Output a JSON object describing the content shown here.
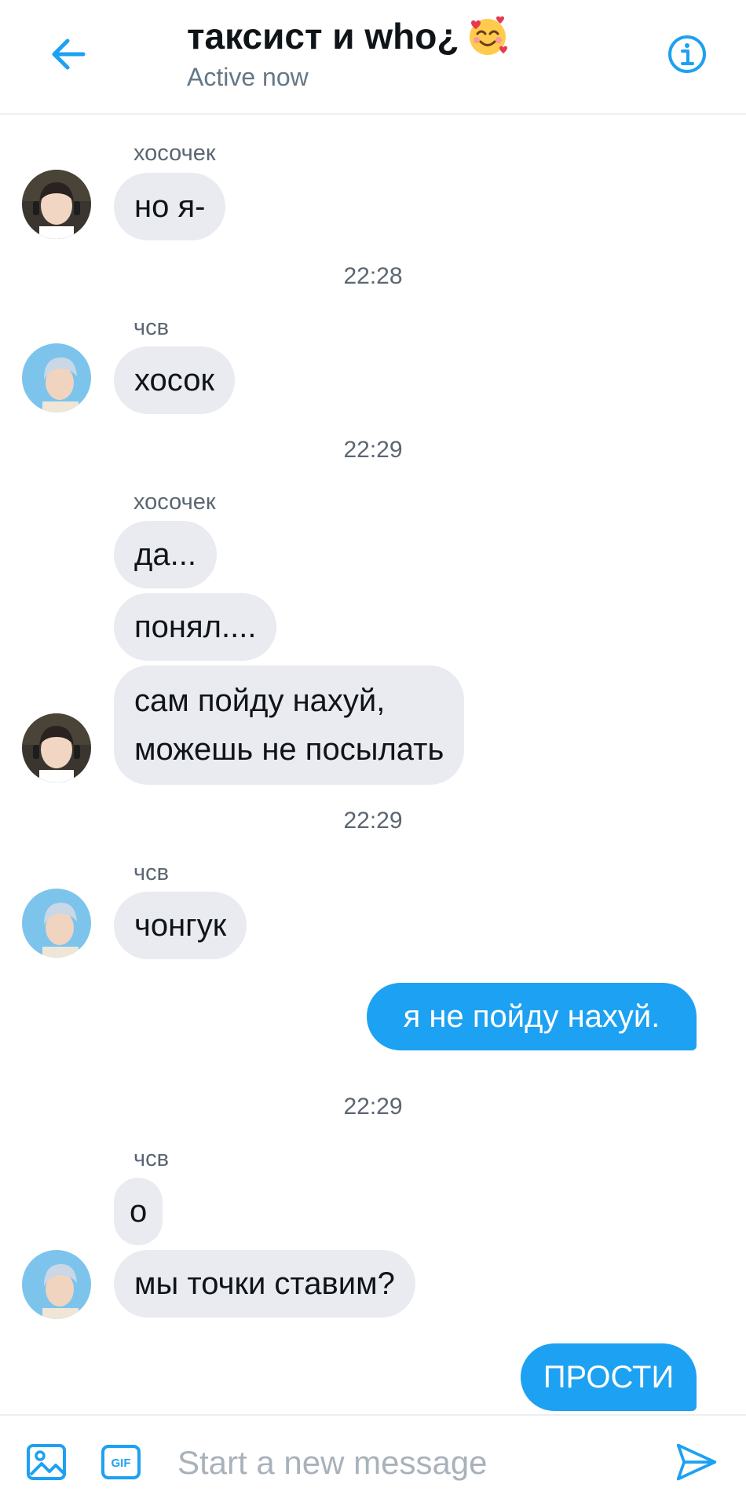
{
  "header": {
    "title": "таксист и who¿",
    "title_emoji": "smiling-face-with-hearts",
    "subtitle": "Active now",
    "back_icon": "arrow-left-icon",
    "info_icon": "info-icon"
  },
  "messages": {
    "g1": {
      "sender": "хосочек",
      "m1": "но я-",
      "time": "22:28"
    },
    "g2": {
      "sender": "чсв",
      "m1": "хосок",
      "time": "22:29"
    },
    "g3": {
      "sender": "хосочек",
      "m1": "да...",
      "m2": "понял....",
      "m3a": "сам пойду нахуй,",
      "m3b": "можешь не посылать",
      "time": "22:29"
    },
    "g4": {
      "sender": "чсв",
      "m1": "чонгук"
    },
    "out1": "я не пойду нахуй.",
    "g5": {
      "time": "22:29",
      "sender": "чсв",
      "m1": "о",
      "m2": "мы точки ставим?"
    },
    "out2": "ПРОСТИ"
  },
  "composer": {
    "placeholder": "Start a new message",
    "image_icon": "image-icon",
    "gif_label": "GIF",
    "send_icon": "send-icon"
  },
  "colors": {
    "accent": "#1da1f2",
    "incoming_bubble": "#e9ebf1",
    "secondary_text": "#5b6672"
  }
}
